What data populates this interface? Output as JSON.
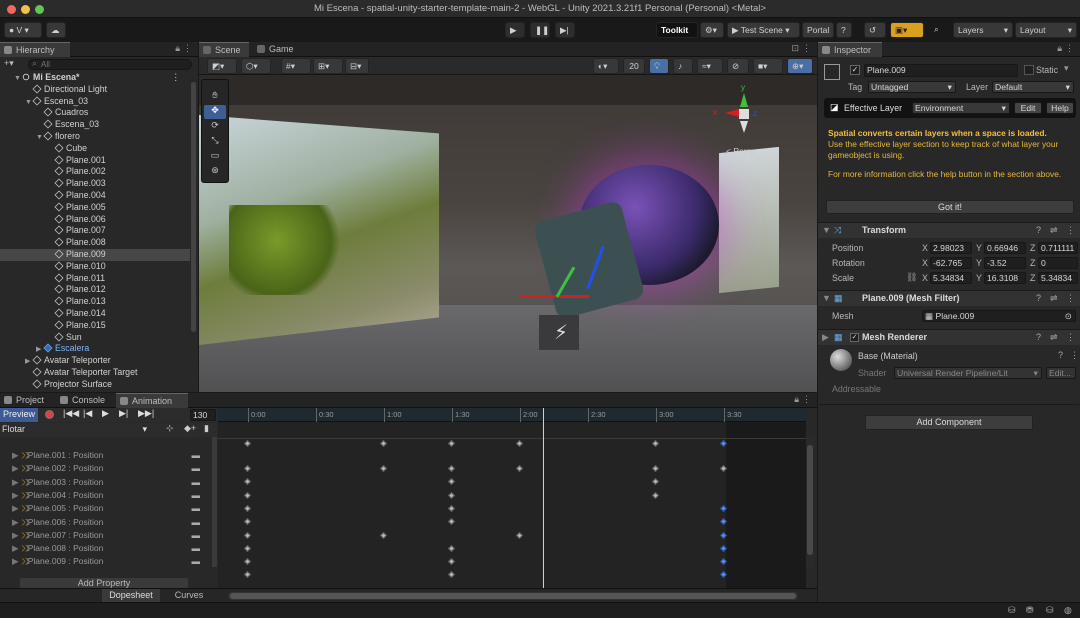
{
  "window": {
    "title": "Mi Escena - spatial-unity-starter-template-main-2 - WebGL - Unity 2021.3.21f1 Personal (Personal) <Metal>"
  },
  "toolbar": {
    "account": "V",
    "toolkit": "Toolkit",
    "test_scene": "Test Scene",
    "portal": "Portal",
    "layers": "Layers",
    "layout": "Layout"
  },
  "hierarchy": {
    "tab": "Hierarchy",
    "search_placeholder": "All",
    "items": [
      {
        "label": "Mi Escena*",
        "depth": 0,
        "kind": "scene",
        "arrow": "▼"
      },
      {
        "label": "Directional Light",
        "depth": 1,
        "kind": "obj",
        "arrow": ""
      },
      {
        "label": "Escena_03",
        "depth": 1,
        "kind": "obj",
        "arrow": "▼"
      },
      {
        "label": "Cuadros",
        "depth": 2,
        "kind": "obj",
        "arrow": ""
      },
      {
        "label": "Escena_03",
        "depth": 2,
        "kind": "obj",
        "arrow": ""
      },
      {
        "label": "florero",
        "depth": 2,
        "kind": "obj",
        "arrow": "▼"
      },
      {
        "label": "Cube",
        "depth": 3,
        "kind": "obj",
        "arrow": ""
      },
      {
        "label": "Plane.001",
        "depth": 3,
        "kind": "obj",
        "arrow": ""
      },
      {
        "label": "Plane.002",
        "depth": 3,
        "kind": "obj",
        "arrow": ""
      },
      {
        "label": "Plane.003",
        "depth": 3,
        "kind": "obj",
        "arrow": ""
      },
      {
        "label": "Plane.004",
        "depth": 3,
        "kind": "obj",
        "arrow": ""
      },
      {
        "label": "Plane.005",
        "depth": 3,
        "kind": "obj",
        "arrow": ""
      },
      {
        "label": "Plane.006",
        "depth": 3,
        "kind": "obj",
        "arrow": ""
      },
      {
        "label": "Plane.007",
        "depth": 3,
        "kind": "obj",
        "arrow": ""
      },
      {
        "label": "Plane.008",
        "depth": 3,
        "kind": "obj",
        "arrow": ""
      },
      {
        "label": "Plane.009",
        "depth": 3,
        "kind": "obj",
        "arrow": "",
        "selected": true
      },
      {
        "label": "Plane.010",
        "depth": 3,
        "kind": "obj",
        "arrow": ""
      },
      {
        "label": "Plane.011",
        "depth": 3,
        "kind": "obj",
        "arrow": ""
      },
      {
        "label": "Plane.012",
        "depth": 3,
        "kind": "obj",
        "arrow": ""
      },
      {
        "label": "Plane.013",
        "depth": 3,
        "kind": "obj",
        "arrow": ""
      },
      {
        "label": "Plane.014",
        "depth": 3,
        "kind": "obj",
        "arrow": ""
      },
      {
        "label": "Plane.015",
        "depth": 3,
        "kind": "obj",
        "arrow": ""
      },
      {
        "label": "Sun",
        "depth": 3,
        "kind": "obj",
        "arrow": ""
      },
      {
        "label": "Escalera",
        "depth": 2,
        "kind": "prefab",
        "arrow": "▶"
      },
      {
        "label": "Avatar Teleporter",
        "depth": 1,
        "kind": "obj",
        "arrow": "▶"
      },
      {
        "label": "Avatar Teleporter Target",
        "depth": 1,
        "kind": "obj",
        "arrow": ""
      },
      {
        "label": "Projector Surface",
        "depth": 1,
        "kind": "obj",
        "arrow": ""
      }
    ]
  },
  "scene": {
    "tab_scene": "Scene",
    "tab_game": "Game",
    "grid_value": "20",
    "persp_label": "< Persp",
    "gizmo_x": "x",
    "gizmo_y": "y",
    "gizmo_z": "z"
  },
  "inspector": {
    "tab": "Inspector",
    "object_name": "Plane.009",
    "static_label": "Static",
    "tag_label": "Tag",
    "tag_value": "Untagged",
    "layer_label": "Layer",
    "layer_value": "Default",
    "effective_layer_label": "Effective Layer",
    "effective_layer_value": "Environment",
    "edit_button": "Edit",
    "help_button": "Help",
    "notice_title": "Spatial converts certain layers when a space is loaded.",
    "notice_body": "Use the effective layer section to keep track of what layer your gameobject is using.",
    "notice_body2": "For more information click the help button in the section above.",
    "got_it": "Got it!",
    "transform": {
      "title": "Transform",
      "position_label": "Position",
      "rotation_label": "Rotation",
      "scale_label": "Scale",
      "position": {
        "x": "2.98023",
        "y": "0.66946",
        "z": "0.711111"
      },
      "rotation": {
        "x": "-62.765",
        "y": "-3.52",
        "z": "0"
      },
      "scale": {
        "x": "5.34834",
        "y": "16.3108",
        "z": "5.34834"
      }
    },
    "mesh_filter": {
      "title": "Plane.009 (Mesh Filter)",
      "mesh_label": "Mesh",
      "mesh_value": "Plane.009"
    },
    "mesh_renderer": {
      "title": "Mesh Renderer"
    },
    "material": {
      "name": "Base (Material)",
      "shader_label": "Shader",
      "shader_value": "Universal Render Pipeline/Lit",
      "edit": "Edit..."
    },
    "addressable": "Addressable",
    "add_component": "Add Component"
  },
  "bottom": {
    "tab_project": "Project",
    "tab_console": "Console",
    "tab_animation": "Animation",
    "preview": "Preview",
    "frame": "130",
    "clip": "Flotar",
    "ruler": [
      "0:00",
      "0:30",
      "1:00",
      "1:30",
      "2:00",
      "2:30",
      "3:00",
      "3:30"
    ],
    "tracks": [
      "Plane.001 : Position",
      "Plane.002 : Position",
      "Plane.003 : Position",
      "Plane.004 : Position",
      "Plane.005 : Position",
      "Plane.006 : Position",
      "Plane.007 : Position",
      "Plane.008 : Position",
      "Plane.009 : Position"
    ],
    "add_property": "Add Property",
    "dopesheet": "Dopesheet",
    "curves": "Curves"
  },
  "colors": {
    "accent": "#3c5a96",
    "notice": "#f0c040",
    "playhead": "#d0d0d0",
    "key_blue": "#5a8ef5"
  }
}
